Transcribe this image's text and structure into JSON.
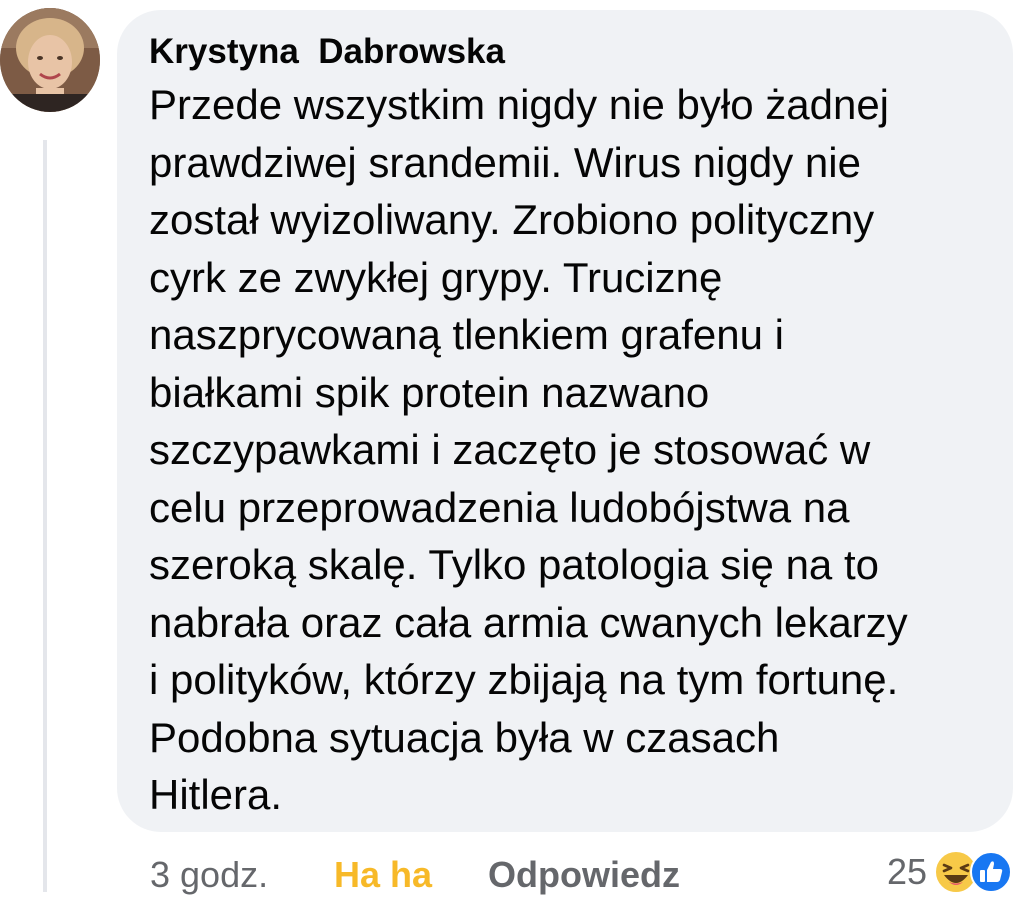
{
  "comment": {
    "author": "Krystyna  Dabrowska",
    "lines": [
      "Przede wszystkim nigdy nie było żadnej",
      "prawdziwej srandemii. Wirus nigdy nie",
      "został wyizoliwany. Zrobiono polityczny",
      "cyrk ze zwykłej grypy. Truciznę",
      "naszprycowaną tlenkiem grafenu i",
      "białkami spik protein nazwano",
      "szczypawkami i zaczęto je stosować w",
      "celu przeprowadzenia ludobójstwa na",
      "szeroką skalę. Tylko patologia się na to",
      "nabrała oraz cała armia cwanych lekarzy",
      "i polityków, którzy zbijają na tym fortunę.",
      "Podobna sytuacja była w czasach",
      "Hitlera."
    ]
  },
  "actions": {
    "time": "3 godz.",
    "reaction": "Ha ha",
    "reply": "Odpowiedz"
  },
  "reactions": {
    "count": "25",
    "icons": [
      "haha-reaction-icon",
      "like-reaction-icon"
    ]
  },
  "colors": {
    "bubble": "#f0f2f5",
    "text": "#050505",
    "muted": "#65676b",
    "haha": "#f7b928",
    "like": "#1877f2",
    "avatar_ring": "#b455c8"
  }
}
